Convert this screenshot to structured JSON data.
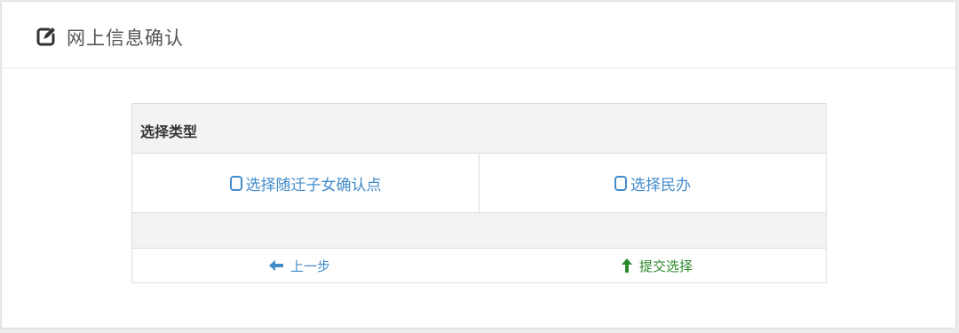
{
  "header": {
    "title": "网上信息确认",
    "icon": "edit-icon"
  },
  "table": {
    "header_label": "选择类型",
    "options": [
      {
        "label": "选择随迁子女确认点",
        "icon": "radio-unchecked-icon"
      },
      {
        "label": "选择民办",
        "icon": "radio-unchecked-icon"
      }
    ],
    "actions": {
      "prev_label": "上一步",
      "prev_icon": "arrow-left-icon",
      "submit_label": "提交选择",
      "submit_icon": "arrow-up-icon"
    }
  },
  "colors": {
    "link_blue": "#428bca",
    "submit_green": "#2c8a2c",
    "header_gray": "#f3f3f3"
  }
}
